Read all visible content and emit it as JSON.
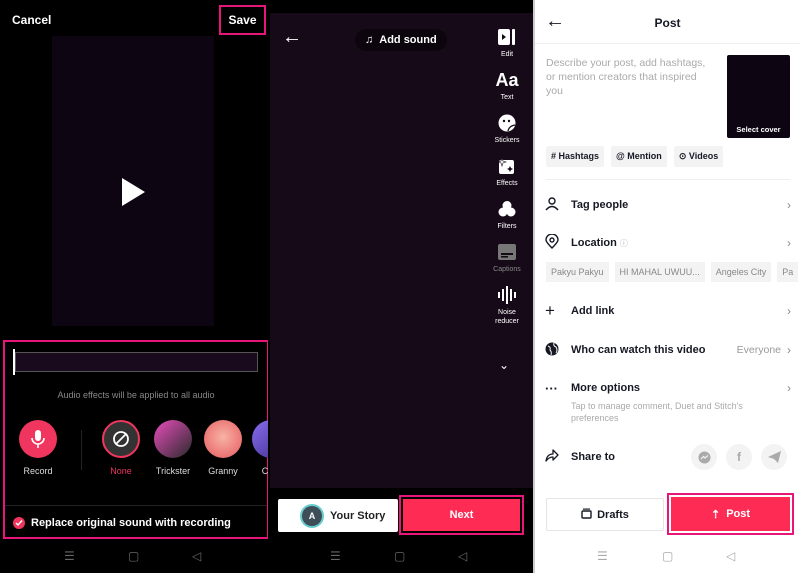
{
  "panel_edit_audio": {
    "cancel_label": "Cancel",
    "save_label": "Save",
    "hint": "Audio effects will be applied to all audio",
    "record_label": "Record",
    "effects": [
      {
        "label": "None",
        "selected": true
      },
      {
        "label": "Trickster"
      },
      {
        "label": "Granny"
      },
      {
        "label": "Chip"
      }
    ],
    "replace_label": "Replace original sound with recording",
    "replace_checked": true
  },
  "panel_editor": {
    "add_sound_label": "Add sound",
    "tools": [
      {
        "label": "Edit",
        "icon": "edit-icon"
      },
      {
        "label": "Text",
        "icon": "text-icon"
      },
      {
        "label": "Stickers",
        "icon": "sticker-icon"
      },
      {
        "label": "Effects",
        "icon": "effects-icon"
      },
      {
        "label": "Filters",
        "icon": "filters-icon"
      },
      {
        "label": "Captions",
        "icon": "captions-icon"
      },
      {
        "label": "Noise reducer",
        "icon": "noise-reducer-icon"
      }
    ],
    "story_avatar": "A",
    "story_label": "Your Story",
    "next_label": "Next"
  },
  "panel_post": {
    "title": "Post",
    "description_placeholder": "Describe your post, add hashtags, or mention creators that inspired you",
    "select_cover_label": "Select cover",
    "chips": [
      "# Hashtags",
      "@ Mention",
      "Videos"
    ],
    "tag_people_label": "Tag people",
    "location_label": "Location",
    "locations": [
      "Pakyu Pakyu",
      "HI MAHAL UWUU...",
      "Angeles City",
      "Pa"
    ],
    "add_link_label": "Add link",
    "who_can_watch_label": "Who can watch this video",
    "who_can_watch_value": "Everyone",
    "more_options_label": "More options",
    "more_options_sub": "Tap to manage comment, Duet and Stitch's preferences",
    "share_to_label": "Share to",
    "drafts_label": "Drafts",
    "post_label": "Post"
  },
  "colors": {
    "accent": "#fe2c55",
    "highlight": "#e8157a"
  }
}
